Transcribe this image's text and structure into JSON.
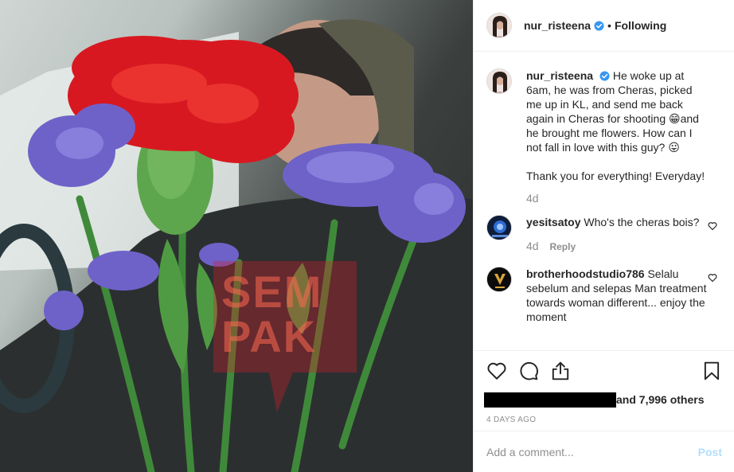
{
  "post": {
    "author": "nur_risteena",
    "separator": "•",
    "follow_status": "Following"
  },
  "caption": {
    "user": "nur_risteena",
    "text": "He woke up at 6am, he was from Cheras, picked me up in KL, and send me back again in Cheras for shooting 😁and he brought me flowers. How can I not fall in love with this guy? 😛",
    "text2": "Thank you for everything! Everyday!",
    "age": "4d"
  },
  "comments": [
    {
      "user": "yesitsatoy",
      "text": "Who's the cheras bois?",
      "age": "4d",
      "reply": "Reply"
    },
    {
      "user": "brotherhoodstudio786",
      "text": "Selalu sebelum and selepas Man treatment towards woman different... enjoy the moment"
    }
  ],
  "likes": {
    "suffix": "and 7,996 others"
  },
  "timestamp": "4 DAYS AGO",
  "add_comment": {
    "placeholder": "Add a comment...",
    "post_label": "Post"
  },
  "watermark": {
    "line1": "SEM",
    "line2": "PAK"
  },
  "colors": {
    "accent_blue": "#3897f0",
    "post_disabled": "#b2dffc",
    "border": "#efefef",
    "muted": "#8e8e8e"
  },
  "icons": [
    "verified-badge-icon",
    "heart-icon",
    "comment-icon",
    "share-icon",
    "bookmark-icon"
  ]
}
